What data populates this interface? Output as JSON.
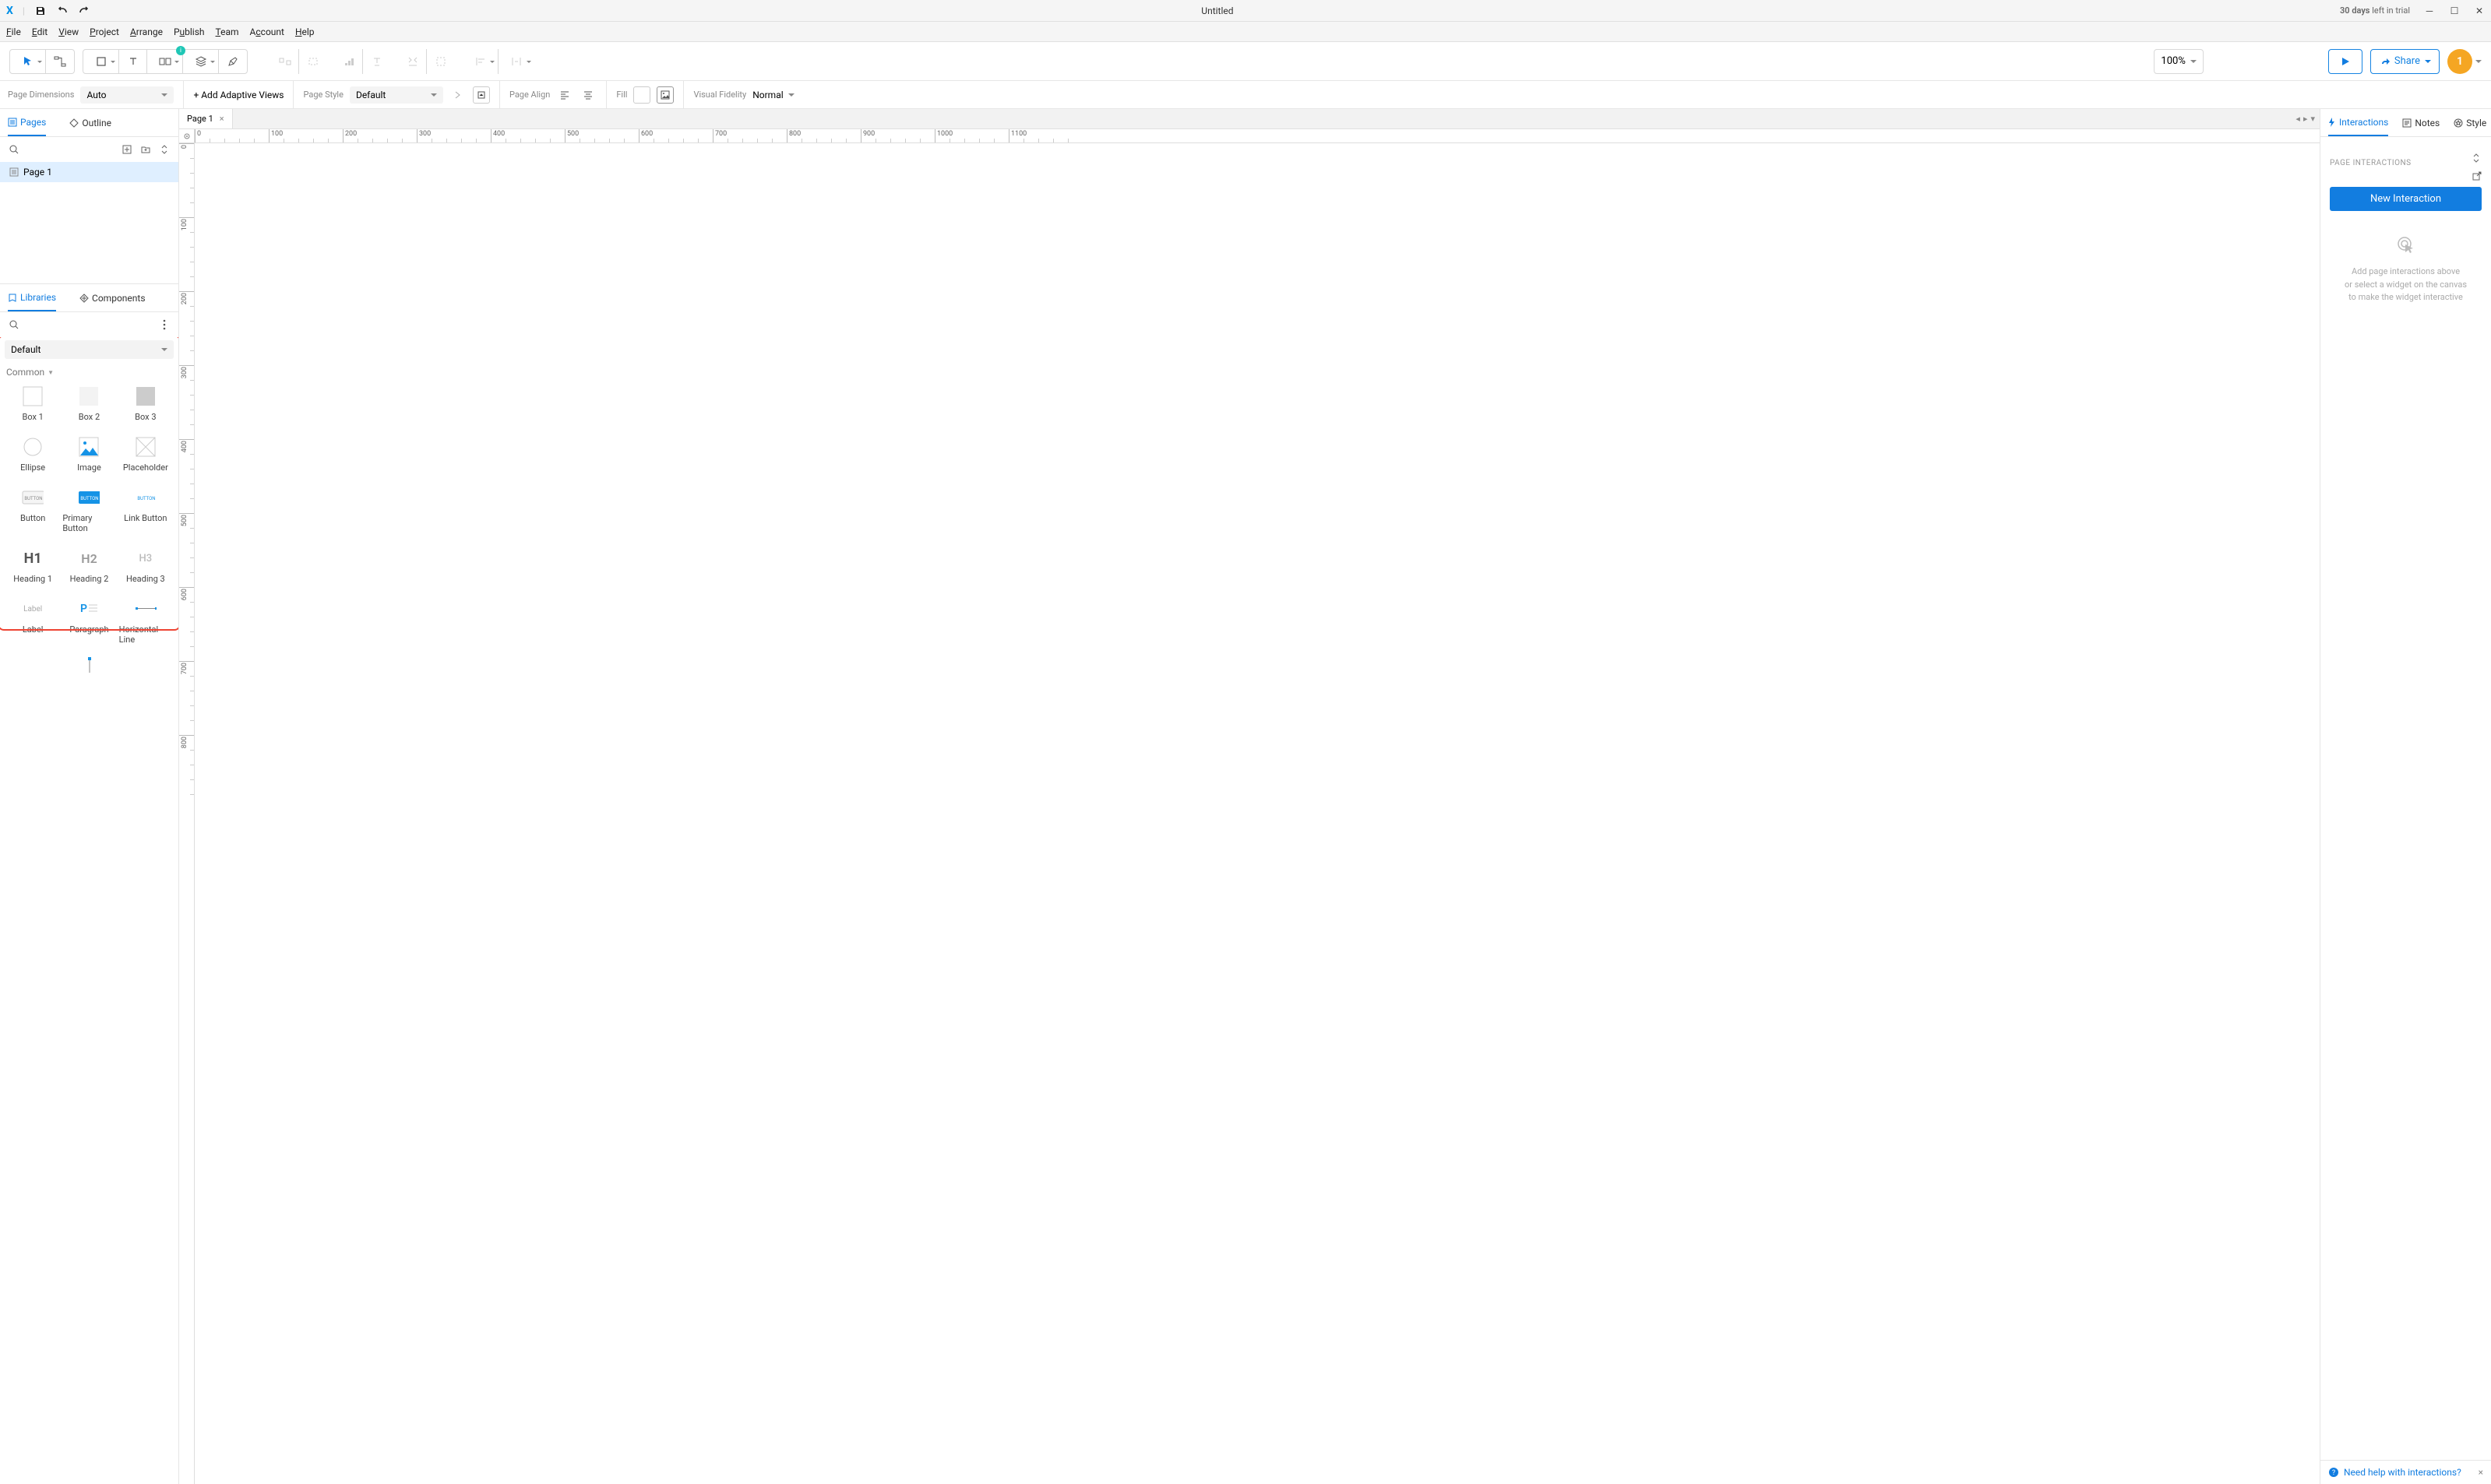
{
  "titlebar": {
    "title": "Untitled",
    "trial_days": "30 days",
    "trial_suffix": "left in trial"
  },
  "menubar": [
    "File",
    "Edit",
    "View",
    "Project",
    "Arrange",
    "Publish",
    "Team",
    "Account",
    "Help"
  ],
  "toolbar": {
    "zoom": "100%",
    "share": "Share",
    "avatar": "1"
  },
  "optionsbar": {
    "page_dimensions_label": "Page Dimensions",
    "page_dimensions_value": "Auto",
    "adaptive_views": "+ Add Adaptive Views",
    "page_style_label": "Page Style",
    "page_style_value": "Default",
    "page_align_label": "Page Align",
    "fill_label": "Fill",
    "visual_fidelity_label": "Visual Fidelity",
    "visual_fidelity_value": "Normal"
  },
  "left": {
    "tabs": {
      "pages": "Pages",
      "outline": "Outline"
    },
    "page1": "Page 1",
    "lower_tabs": {
      "libraries": "Libraries",
      "components": "Components"
    },
    "lib_select": "Default",
    "lib_category": "Common",
    "widgets": [
      "Box 1",
      "Box 2",
      "Box 3",
      "Ellipse",
      "Image",
      "Placeholder",
      "Button",
      "Primary Button",
      "Link Button",
      "Heading 1",
      "Heading 2",
      "Heading 3",
      "Label",
      "Paragraph",
      "Horizontal Line"
    ]
  },
  "tab": {
    "name": "Page 1"
  },
  "right": {
    "tabs": {
      "interactions": "Interactions",
      "notes": "Notes",
      "style": "Style"
    },
    "section": "PAGE INTERACTIONS",
    "new_btn": "New Interaction",
    "empty1": "Add page interactions above",
    "empty2": "or select a widget on the canvas",
    "empty3": "to make the widget interactive",
    "footer": "Need help with interactions?"
  },
  "ruler": {
    "h_majors": [
      0,
      100,
      200,
      300,
      400,
      500,
      600,
      700,
      800,
      900,
      1000,
      1100
    ],
    "v_majors": [
      0,
      100,
      200,
      300,
      400,
      500,
      600,
      700,
      800
    ]
  }
}
